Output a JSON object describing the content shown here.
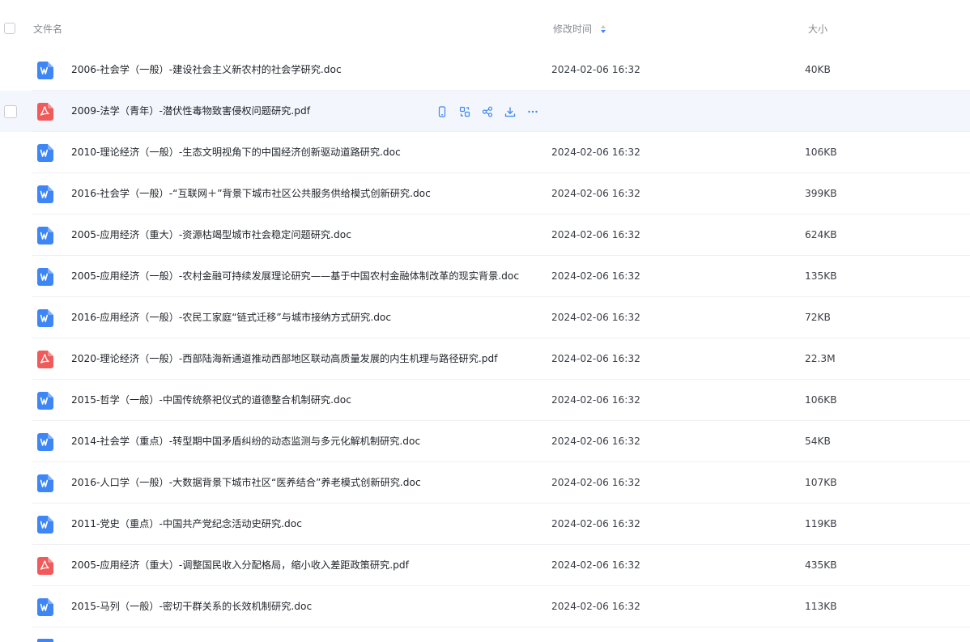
{
  "header": {
    "name_label": "文件名",
    "time_label": "修改时间",
    "size_label": "大小"
  },
  "colors": {
    "doc_icon": "#3e86f5",
    "pdf_icon": "#f05a5a",
    "action_icon": "#3e86f5",
    "hover_row": "#f3f6fc"
  },
  "files": [
    {
      "type": "doc",
      "name": "2006-社会学（一般）-建设社会主义新农村的社会学研究.doc",
      "time": "2024-02-06 16:32",
      "size": "40KB"
    },
    {
      "type": "pdf",
      "name": "2009-法学（青年）-潜伏性毒物致害侵权问题研究.pdf",
      "time": "",
      "size": ""
    },
    {
      "type": "doc",
      "name": "2010-理论经济（一般）-生态文明视角下的中国经济创新驱动道路研究.doc",
      "time": "2024-02-06 16:32",
      "size": "106KB"
    },
    {
      "type": "doc",
      "name": "2016-社会学（一般）-“互联网＋”背景下城市社区公共服务供给模式创新研究.doc",
      "time": "2024-02-06 16:32",
      "size": "399KB"
    },
    {
      "type": "doc",
      "name": "2005-应用经济（重大）-资源枯竭型城市社会稳定问题研究.doc",
      "time": "2024-02-06 16:32",
      "size": "624KB"
    },
    {
      "type": "doc",
      "name": "2005-应用经济（一般）-农村金融可持续发展理论研究——基于中国农村金融体制改革的现实背景.doc",
      "time": "2024-02-06 16:32",
      "size": "135KB"
    },
    {
      "type": "doc",
      "name": "2016-应用经济（一般）-农民工家庭“链式迁移”与城市接纳方式研究.doc",
      "time": "2024-02-06 16:32",
      "size": "72KB"
    },
    {
      "type": "pdf",
      "name": "2020-理论经济（一般）-西部陆海新通道推动西部地区联动高质量发展的内生机理与路径研究.pdf",
      "time": "2024-02-06 16:32",
      "size": "22.3M"
    },
    {
      "type": "doc",
      "name": "2015-哲学（一般）-中国传统祭祀仪式的道德整合机制研究.doc",
      "time": "2024-02-06 16:32",
      "size": "106KB"
    },
    {
      "type": "doc",
      "name": "2014-社会学（重点）-转型期中国矛盾纠纷的动态监测与多元化解机制研究.doc",
      "time": "2024-02-06 16:32",
      "size": "54KB"
    },
    {
      "type": "doc",
      "name": "2016-人口学（一般）-大数据背景下城市社区“医养结合”养老模式创新研究.doc",
      "time": "2024-02-06 16:32",
      "size": "107KB"
    },
    {
      "type": "doc",
      "name": "2011-党史（重点）-中国共产党纪念活动史研究.doc",
      "time": "2024-02-06 16:32",
      "size": "119KB"
    },
    {
      "type": "pdf",
      "name": "2005-应用经济（重大）-调整国民收入分配格局，缩小收入差距政策研究.pdf",
      "time": "2024-02-06 16:32",
      "size": "435KB"
    },
    {
      "type": "doc",
      "name": "2015-马列（一般）-密切干群关系的长效机制研究.doc",
      "time": "2024-02-06 16:32",
      "size": "113KB"
    }
  ],
  "hover_actions": [
    {
      "icon": "phone-icon"
    },
    {
      "icon": "convert-icon"
    },
    {
      "icon": "share-icon"
    },
    {
      "icon": "download-icon"
    },
    {
      "icon": "more-icon"
    }
  ]
}
